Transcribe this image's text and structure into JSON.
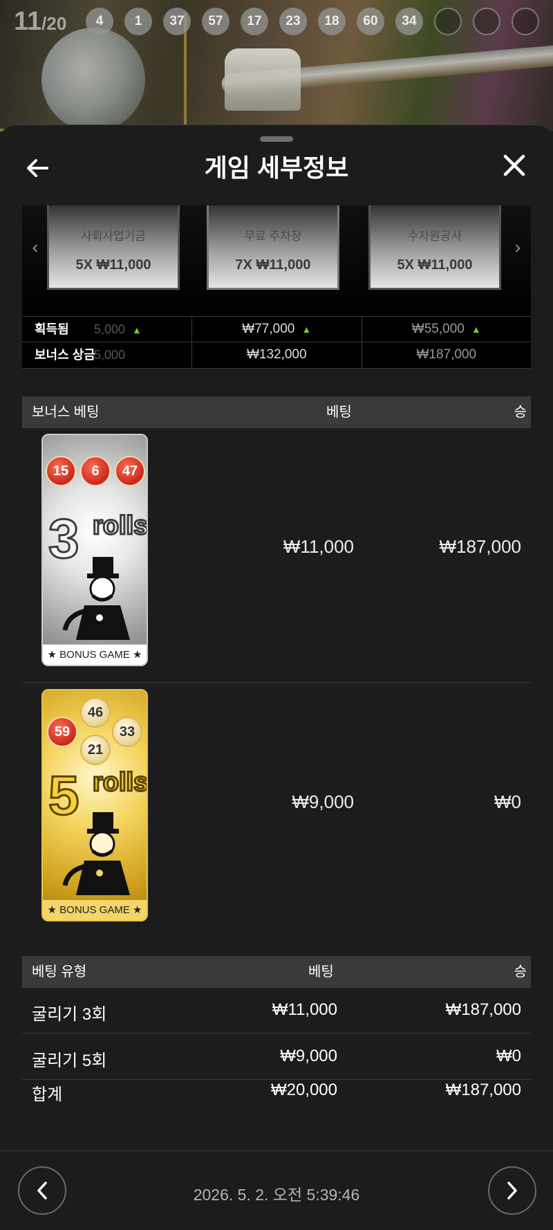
{
  "live": {
    "round_current": "11",
    "round_total": "/20",
    "history": [
      "4",
      "1",
      "37",
      "57",
      "17",
      "23",
      "18",
      "60",
      "34",
      "",
      "",
      ""
    ]
  },
  "sheet": {
    "title": "게임 세부정보",
    "back_icon": "arrow-left-icon",
    "close_icon": "close-icon"
  },
  "properties": [
    {
      "name": "사회사업기금",
      "multiplier": "5X ₩11,000"
    },
    {
      "name": "무료 주차장",
      "multiplier": "7X ₩11,000"
    },
    {
      "name": "수자원공사",
      "multiplier": "5X ₩11,000"
    }
  ],
  "summary": {
    "won_label": "획득됨",
    "won_partial": "5,000",
    "won_values": [
      "₩77,000",
      "₩55,000"
    ],
    "bonus_label": "보너스 상금",
    "bonus_partial": "5,000",
    "bonus_values": [
      "₩132,000",
      "₩187,000"
    ]
  },
  "bonus_table": {
    "headers": [
      "보너스 베팅",
      "베팅",
      "승"
    ],
    "rows": [
      {
        "balls": [
          "15",
          "6",
          "47"
        ],
        "rolls": "3",
        "rolls_word": "rolls",
        "footer": "★ BONUS GAME ★",
        "bet": "₩11,000",
        "win": "₩187,000"
      },
      {
        "balls": [
          "46",
          "59",
          "33",
          "21"
        ],
        "rolls": "5",
        "rolls_word": "rolls",
        "footer": "★ BONUS GAME ★",
        "bet": "₩9,000",
        "win": "₩0"
      }
    ]
  },
  "type_table": {
    "headers": [
      "베팅 유형",
      "베팅",
      "승"
    ],
    "rows": [
      {
        "type": "굴리기 3회",
        "bet": "₩11,000",
        "win": "₩187,000"
      },
      {
        "type": "굴리기 5회",
        "bet": "₩9,000",
        "win": "₩0"
      }
    ],
    "total": {
      "type": "합계",
      "bet": "₩20,000",
      "win": "₩187,000"
    }
  },
  "footer": {
    "timestamp": "2026. 5. 2. 오전 5:39:46",
    "prev_icon": "chevron-left-icon",
    "next_icon": "chevron-right-icon"
  },
  "colors": {
    "accent_up": "#6bd31f",
    "sheet_bg": "#1c1c1c",
    "header_bg": "#3a3a3a"
  }
}
